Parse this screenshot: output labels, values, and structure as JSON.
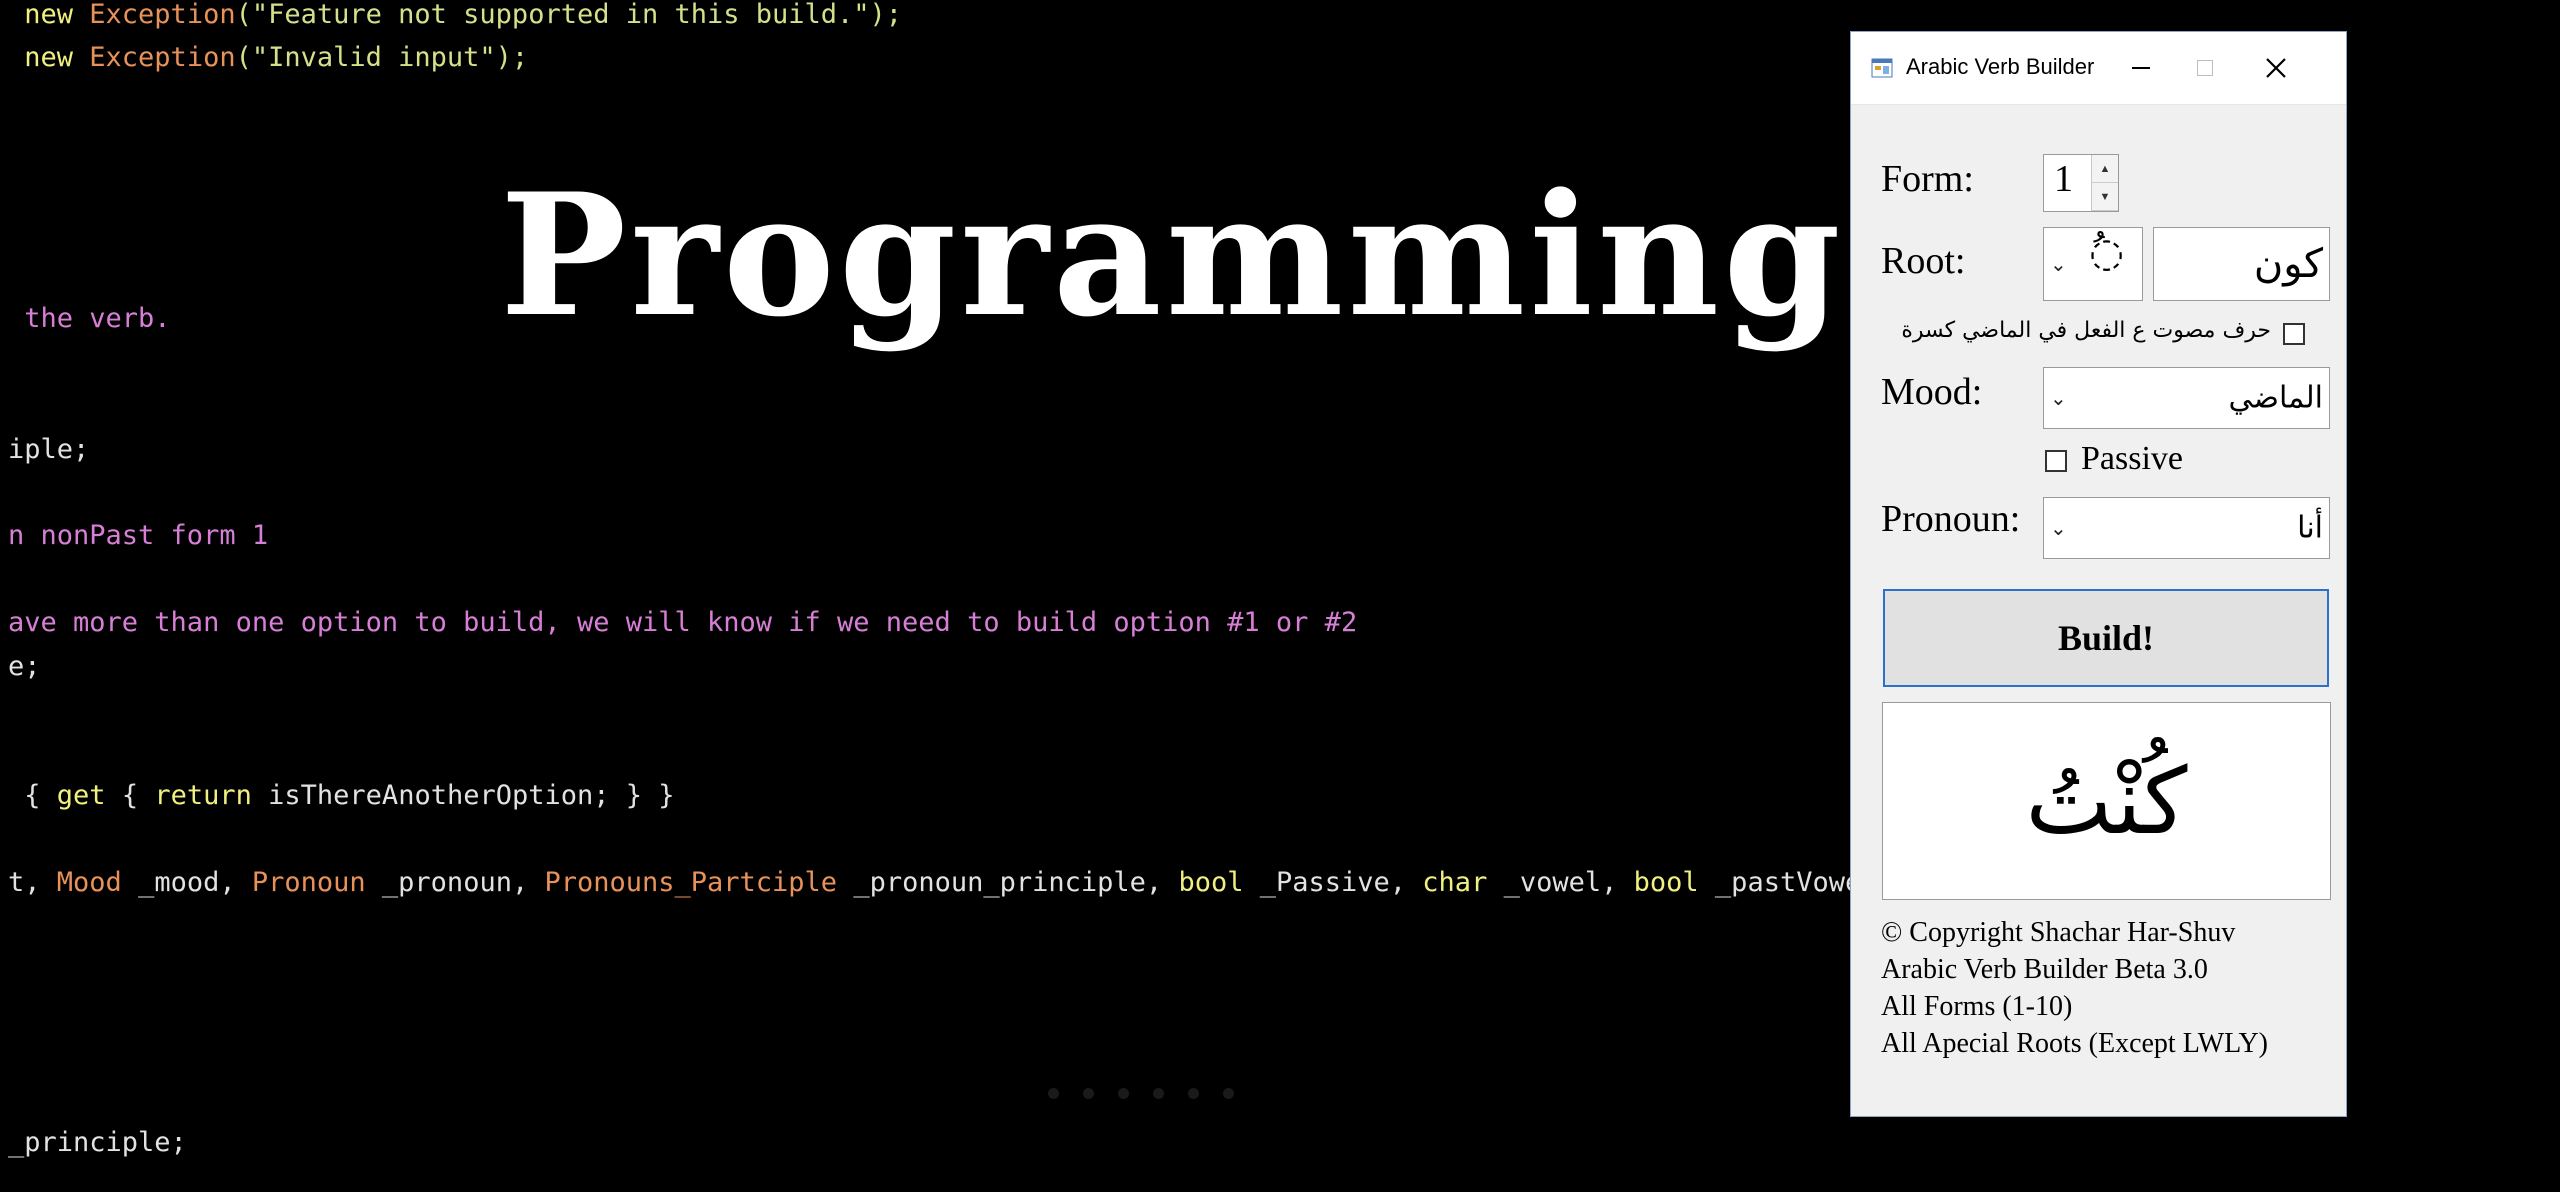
{
  "background": {
    "title": "Programming",
    "code_lines": [
      {
        "parts": [
          {
            "c": "kw",
            "t": " new "
          },
          {
            "c": "ty",
            "t": "Exception"
          },
          {
            "c": "str",
            "t": "(\"Feature not supported in this build.\");"
          }
        ]
      },
      {
        "parts": [
          {
            "c": "kw",
            "t": " new "
          },
          {
            "c": "ty",
            "t": "Exception"
          },
          {
            "c": "str",
            "t": "(\"Invalid input\");"
          }
        ]
      },
      {
        "parts": [
          {
            "c": "cmt",
            "t": " the verb."
          }
        ]
      },
      {
        "parts": [
          {
            "c": "txt",
            "t": "iple;"
          }
        ]
      },
      {
        "parts": [
          {
            "c": "cmt",
            "t": "n nonPast form 1"
          }
        ]
      },
      {
        "parts": [
          {
            "c": "cmt",
            "t": "ave more than one option to build, we will know if we need to build option #1 or #2"
          }
        ]
      },
      {
        "parts": [
          {
            "c": "txt",
            "t": "e;"
          }
        ]
      },
      {
        "parts": [
          {
            "c": "txt",
            "t": " { "
          },
          {
            "c": "kw",
            "t": "get"
          },
          {
            "c": "txt",
            "t": " { "
          },
          {
            "c": "kw",
            "t": "return"
          },
          {
            "c": "txt",
            "t": " isThereAnotherOption; } }"
          }
        ]
      },
      {
        "parts": [
          {
            "c": "txt",
            "t": "t, "
          },
          {
            "c": "ty",
            "t": "Mood"
          },
          {
            "c": "txt",
            "t": " _mood, "
          },
          {
            "c": "ty",
            "t": "Pronoun"
          },
          {
            "c": "txt",
            "t": " _pronoun, "
          },
          {
            "c": "ty",
            "t": "Pronouns_Partciple"
          },
          {
            "c": "txt",
            "t": " _pronoun_principle, "
          },
          {
            "c": "kw",
            "t": "bool"
          },
          {
            "c": "txt",
            "t": " _Passive, "
          },
          {
            "c": "kw",
            "t": "char"
          },
          {
            "c": "txt",
            "t": " _vowel, "
          },
          {
            "c": "kw",
            "t": "bool"
          },
          {
            "c": "txt",
            "t": " _pastVowelKas"
          }
        ]
      },
      {
        "parts": [
          {
            "c": "txt",
            "t": "_principle;"
          }
        ]
      }
    ]
  },
  "window": {
    "title": "Arabic Verb Builder",
    "form": {
      "label": "Form:",
      "value": "1"
    },
    "root": {
      "label": "Root:",
      "vowel": "ُ",
      "value": "كون"
    },
    "kasra_checkbox": {
      "label": "حرف مصوت ع الفعل في الماضي كسرة",
      "checked": false
    },
    "mood": {
      "label": "Mood:",
      "value": "الماضي"
    },
    "passive": {
      "label": "Passive",
      "checked": false
    },
    "pronoun": {
      "label": "Pronoun:",
      "value": "أنا"
    },
    "build_label": "Build!",
    "result": "كُنْتُ",
    "footer": [
      "© Copyright Shachar Har-Shuv",
      "Arabic Verb Builder Beta 3.0",
      "All Forms (1-10)",
      "All Apecial Roots (Except LWLY)"
    ]
  },
  "icons": {
    "app": "app-window-icon",
    "minimize": "minimize-icon",
    "maximize": "maximize-icon",
    "close": "close-icon",
    "dropdown": "chevron-down-icon",
    "spin_up": "spin-up-icon",
    "spin_down": "spin-down-icon"
  },
  "colors": {
    "keyword": "#f0f080",
    "type": "#e8925a",
    "string": "#d6e08a",
    "comment": "#d77fd6",
    "build_border": "#2c6fcd"
  }
}
